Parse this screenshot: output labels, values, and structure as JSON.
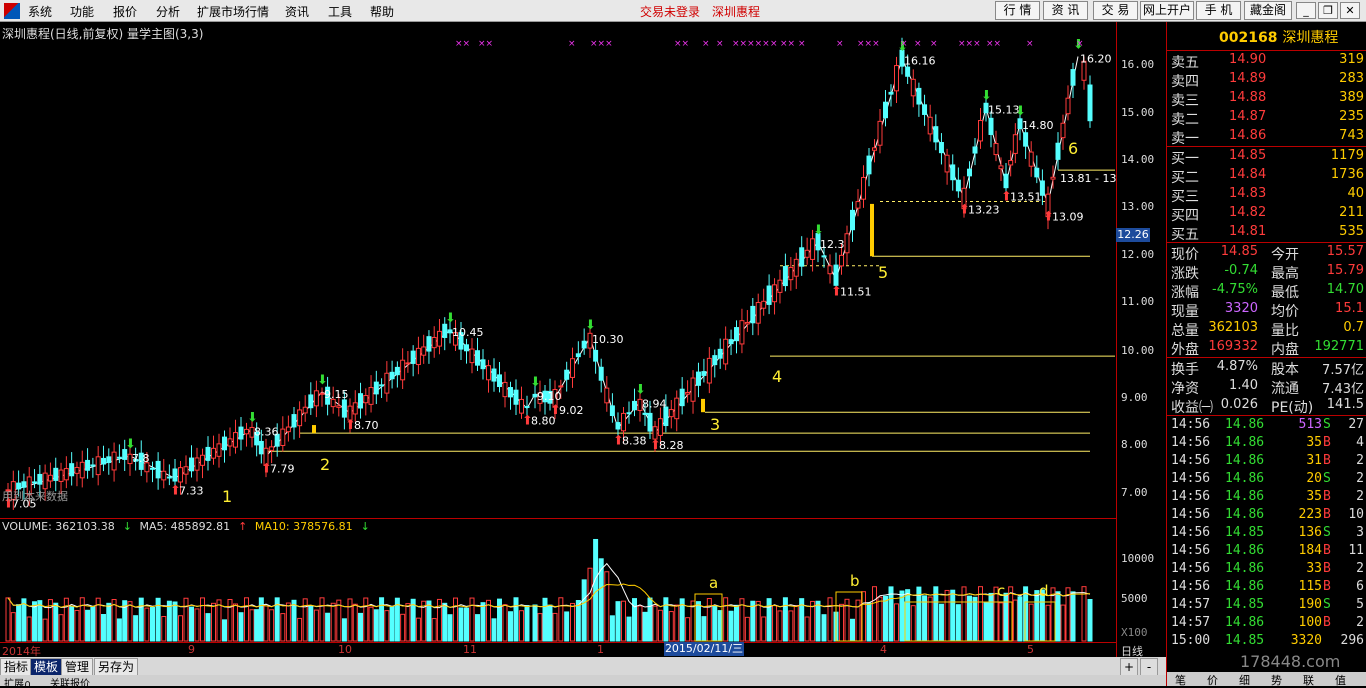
{
  "menu": [
    "系统",
    "功能",
    "报价",
    "分析",
    "扩展市场行情",
    "资讯",
    "工具",
    "帮助"
  ],
  "status": {
    "login": "交易未登录",
    "stock": "深圳惠程"
  },
  "topbuttons": [
    "行 情",
    "资 讯",
    "交 易",
    "网上开户",
    "手 机",
    "藏金阁"
  ],
  "chart": {
    "title": "深圳惠程(日线,前复权) 量学主图(3,3)",
    "yticks": [
      "16.00",
      "15.00",
      "14.00",
      "13.00",
      "12.00",
      "11.00",
      "10.00",
      "9.00",
      "8.00",
      "7.00"
    ],
    "current_price": "12.26",
    "vol_yticks": [
      "10000",
      "5000",
      "X100"
    ],
    "no_data": "用到本来数据",
    "annotations": [
      "1",
      "2",
      "3",
      "4",
      "5",
      "6",
      "7.05",
      "7.33",
      "7.79",
      "8.36",
      "8.70",
      "9.15",
      "8.80",
      "9.10",
      "9.02",
      "10.45",
      "10.30",
      "8.38",
      "8.28",
      "8.94",
      "11.51",
      "12.3",
      "16.16",
      "13.23",
      "15.13",
      "13.51",
      "14.80",
      "13.09",
      "16.20",
      "13.81 - 13"
    ],
    "chart_data": {
      "type": "candlestick",
      "symbol": "002168",
      "name": "深圳惠程",
      "ylim": [
        6.7,
        16.4
      ],
      "pivots": [
        {
          "label": "7.05",
          "value": 7.05,
          "kind": "low"
        },
        {
          "label": "7.8",
          "value": 7.8,
          "kind": "high"
        },
        {
          "label": "7.33",
          "value": 7.33,
          "kind": "low"
        },
        {
          "label": "8.36",
          "value": 8.36,
          "kind": "high"
        },
        {
          "label": "7.79",
          "value": 7.79,
          "kind": "low"
        },
        {
          "label": "9.15",
          "value": 9.15,
          "kind": "high"
        },
        {
          "label": "8.70",
          "value": 8.7,
          "kind": "low"
        },
        {
          "label": "10.45",
          "value": 10.45,
          "kind": "high"
        },
        {
          "label": "8.80",
          "value": 8.8,
          "kind": "low"
        },
        {
          "label": "9.10",
          "value": 9.1,
          "kind": "high"
        },
        {
          "label": "9.02",
          "value": 9.02,
          "kind": "low"
        },
        {
          "label": "10.30",
          "value": 10.3,
          "kind": "high"
        },
        {
          "label": "8.38",
          "value": 8.38,
          "kind": "low"
        },
        {
          "label": "8.94",
          "value": 8.94,
          "kind": "high"
        },
        {
          "label": "8.28",
          "value": 8.28,
          "kind": "low"
        },
        {
          "label": "12.3",
          "value": 12.3,
          "kind": "high"
        },
        {
          "label": "11.51",
          "value": 11.51,
          "kind": "low"
        },
        {
          "label": "16.16",
          "value": 16.16,
          "kind": "high"
        },
        {
          "label": "13.23",
          "value": 13.23,
          "kind": "low"
        },
        {
          "label": "15.13",
          "value": 15.13,
          "kind": "high"
        },
        {
          "label": "13.51",
          "value": 13.51,
          "kind": "low"
        },
        {
          "label": "14.80",
          "value": 14.8,
          "kind": "high"
        },
        {
          "label": "13.09",
          "value": 13.09,
          "kind": "low"
        },
        {
          "label": "16.20",
          "value": 16.2,
          "kind": "high"
        }
      ],
      "support_lines": [
        7.9,
        8.28,
        8.72,
        9.9,
        12.0,
        13.15,
        13.81
      ]
    }
  },
  "volume": {
    "title": "VOLUME: 362103.38",
    "ma5": "MA5: 485892.81",
    "ma10": "MA10: 378576.81",
    "labels": [
      "a",
      "b",
      "c",
      "d"
    ]
  },
  "xaxis": {
    "labels": [
      "2014年",
      "9",
      "10",
      "11",
      "1",
      "4",
      "5"
    ],
    "selected_date": "2015/02/11/三",
    "period": "日线"
  },
  "tabs": [
    "指标",
    "模板",
    "管理",
    "另存为"
  ],
  "tabs2": [
    "扩展∩",
    "关联报价"
  ],
  "quote": {
    "code": "002168",
    "name": "深圳惠程",
    "asks": [
      {
        "l": "卖五",
        "p": "14.90",
        "v": "319"
      },
      {
        "l": "卖四",
        "p": "14.89",
        "v": "283"
      },
      {
        "l": "卖三",
        "p": "14.88",
        "v": "389"
      },
      {
        "l": "卖二",
        "p": "14.87",
        "v": "235"
      },
      {
        "l": "卖一",
        "p": "14.86",
        "v": "743"
      }
    ],
    "bids": [
      {
        "l": "买一",
        "p": "14.85",
        "v": "1179"
      },
      {
        "l": "买二",
        "p": "14.84",
        "v": "1736"
      },
      {
        "l": "买三",
        "p": "14.83",
        "v": "40"
      },
      {
        "l": "买四",
        "p": "14.82",
        "v": "211"
      },
      {
        "l": "买五",
        "p": "14.81",
        "v": "535"
      }
    ],
    "info": [
      {
        "a": "现价",
        "b": "14.85",
        "c": "今开",
        "d": "15.57",
        "bc": "#ff3b3b",
        "dc": "#ff3b3b"
      },
      {
        "a": "涨跌",
        "b": "-0.74",
        "c": "最高",
        "d": "15.79",
        "bc": "#33dd33",
        "dc": "#ff3b3b"
      },
      {
        "a": "涨幅",
        "b": "-4.75%",
        "c": "最低",
        "d": "14.70",
        "bc": "#33dd33",
        "dc": "#33dd33"
      },
      {
        "a": "现量",
        "b": "3320",
        "c": "均价",
        "d": "15.1",
        "bc": "#cc66ff",
        "dc": "#ff3b3b"
      },
      {
        "a": "总量",
        "b": "362103",
        "c": "量比",
        "d": "0.7",
        "bc": "#ffcc00",
        "dc": "#ffcc00"
      },
      {
        "a": "外盘",
        "b": "169332",
        "c": "内盘",
        "d": "192771",
        "bc": "#ff3b3b",
        "dc": "#33dd33"
      }
    ],
    "info2": [
      {
        "a": "换手",
        "b": "4.87%",
        "c": "股本",
        "d": "7.57亿"
      },
      {
        "a": "净资",
        "b": "1.40",
        "c": "流通",
        "d": "7.43亿"
      },
      {
        "a": "收益㈠",
        "b": "0.026",
        "c": "PE(动)",
        "d": "141.5"
      }
    ],
    "ticks": [
      {
        "t": "14:56",
        "p": "14.86",
        "v": "513",
        "s": "S",
        "n": "27"
      },
      {
        "t": "14:56",
        "p": "14.86",
        "v": "35",
        "s": "B",
        "n": "4"
      },
      {
        "t": "14:56",
        "p": "14.86",
        "v": "31",
        "s": "B",
        "n": "2"
      },
      {
        "t": "14:56",
        "p": "14.86",
        "v": "20",
        "s": "S",
        "n": "2"
      },
      {
        "t": "14:56",
        "p": "14.86",
        "v": "35",
        "s": "B",
        "n": "2"
      },
      {
        "t": "14:56",
        "p": "14.86",
        "v": "223",
        "s": "B",
        "n": "10"
      },
      {
        "t": "14:56",
        "p": "14.85",
        "v": "136",
        "s": "S",
        "n": "3"
      },
      {
        "t": "14:56",
        "p": "14.86",
        "v": "184",
        "s": "B",
        "n": "11"
      },
      {
        "t": "14:56",
        "p": "14.86",
        "v": "33",
        "s": "B",
        "n": "2"
      },
      {
        "t": "14:56",
        "p": "14.86",
        "v": "115",
        "s": "B",
        "n": "6"
      },
      {
        "t": "14:57",
        "p": "14.85",
        "v": "190",
        "s": "S",
        "n": "5"
      },
      {
        "t": "14:57",
        "p": "14.86",
        "v": "100",
        "s": "B",
        "n": "2"
      },
      {
        "t": "15:00",
        "p": "14.85",
        "v": "3320",
        "s": "",
        "n": "296"
      }
    ],
    "bottom": [
      "笔",
      "价",
      "细",
      "势",
      "联",
      "值"
    ]
  },
  "watermark": "178448.com"
}
